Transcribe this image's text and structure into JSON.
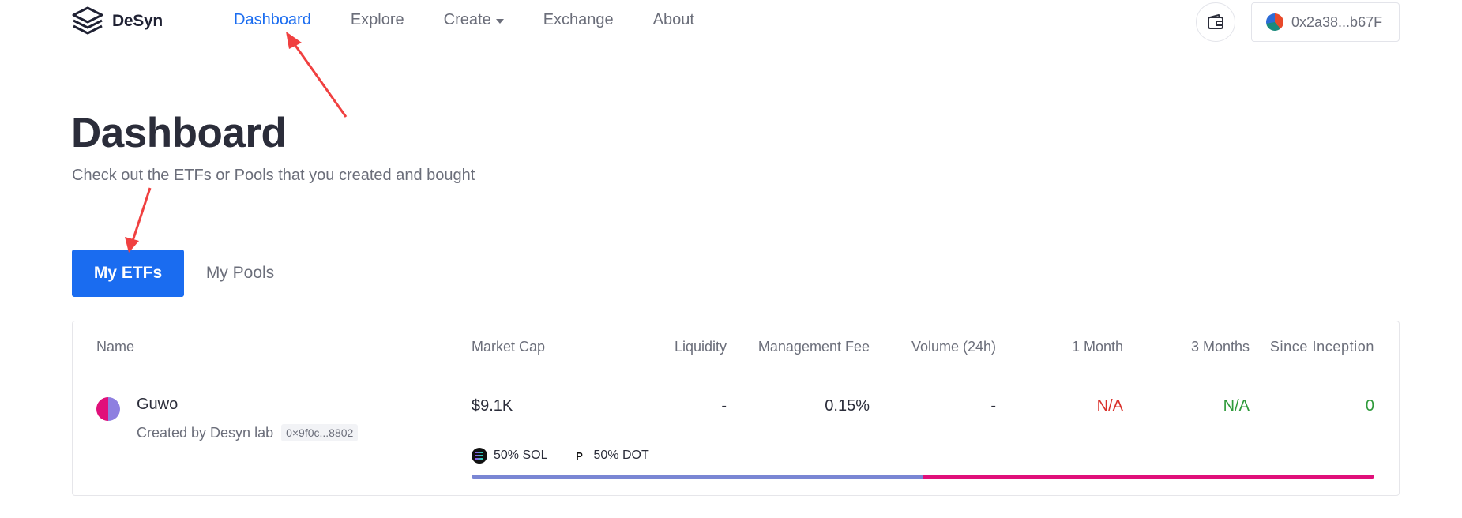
{
  "header": {
    "logo_text": "DeSyn",
    "nav": [
      {
        "label": "Dashboard",
        "active": true
      },
      {
        "label": "Explore",
        "active": false
      },
      {
        "label": "Create",
        "active": false,
        "dropdown": true
      },
      {
        "label": "Exchange",
        "active": false
      },
      {
        "label": "About",
        "active": false
      }
    ],
    "account_address": "0x2a38...b67F"
  },
  "page": {
    "title": "Dashboard",
    "subtitle": "Check out the ETFs or Pools that you created and bought"
  },
  "tabs": [
    {
      "label": "My ETFs",
      "active": true
    },
    {
      "label": "My Pools",
      "active": false
    }
  ],
  "table": {
    "columns": [
      "Name",
      "Market Cap",
      "Liquidity",
      "Management Fee",
      "Volume (24h)",
      "1 Month",
      "3 Months",
      "Since Inception"
    ],
    "rows": [
      {
        "name": "Guwo",
        "creator": "Created by Desyn lab",
        "address": "0×9f0c...8802",
        "market_cap": "$9.1K",
        "liquidity": "-",
        "management_fee": "0.15%",
        "volume_24h": "-",
        "one_month": "N/A",
        "three_months": "N/A",
        "since_inception": "0",
        "tokens": [
          {
            "label": "50% SOL",
            "icon": "solana-icon",
            "share": 0.5,
            "color": "#7a86d4"
          },
          {
            "label": "50% DOT",
            "icon": "polkadot-icon",
            "share": 0.5,
            "color": "#e0107a"
          }
        ]
      }
    ]
  },
  "colors": {
    "accent": "#1a6cf0",
    "negative": "#d9312b",
    "positive": "#2e9a3a",
    "annotation_arrow": "#f04040"
  }
}
